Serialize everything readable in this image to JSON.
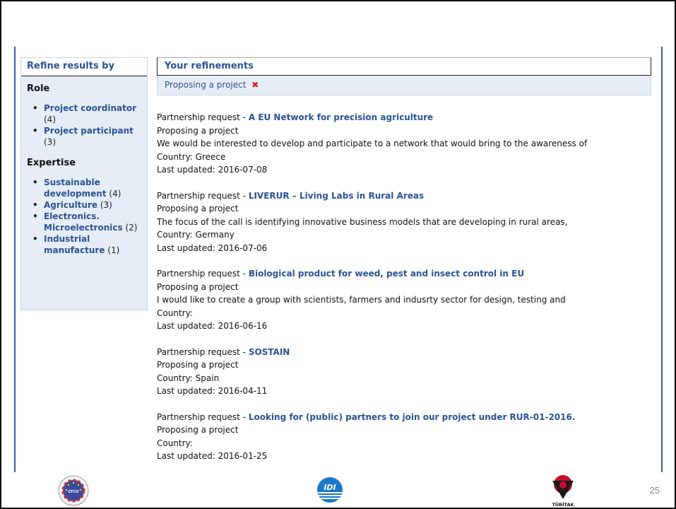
{
  "sidebar": {
    "header": "Refine results by",
    "facets": [
      {
        "title": "Role",
        "items": [
          {
            "label": "Project coordinator",
            "count": "(4)"
          },
          {
            "label": "Project participant",
            "count": "(3)"
          }
        ]
      },
      {
        "title": "Expertise",
        "items": [
          {
            "label": "Sustainable development",
            "count": "(4)"
          },
          {
            "label": "Agriculture",
            "count": "(3)"
          },
          {
            "label": "Electronics. Microelectronics",
            "count": "(2)"
          },
          {
            "label": "Industrial manufacture",
            "count": "(1)"
          }
        ]
      }
    ]
  },
  "refinements": {
    "header": "Your refinements",
    "active": "Proposing a project",
    "remove_glyph": "✖"
  },
  "results": [
    {
      "type": "Partnership request - ",
      "title": "A EU Network for precision agriculture",
      "subtitle": "Proposing a project",
      "description": "We would be interested to develop and participate to a network that would bring to the awareness of",
      "country": "Country: Greece",
      "updated": "Last updated: 2016-07-08"
    },
    {
      "type": "Partnership request - ",
      "title": "LIVERUR – Living Labs in Rural Areas",
      "subtitle": "Proposing a project",
      "description": "The focus of the call is identifying innovative business models that are developing in rural areas,",
      "country": "Country: Germany",
      "updated": "Last updated: 2016-07-06"
    },
    {
      "type": "Partnership request - ",
      "title": "Biological product for weed, pest and insect control in EU",
      "subtitle": "Proposing a project",
      "description": "I would like to create a group with scientists, farmers and indusrty sector for design, testing and",
      "country": "Country:",
      "updated": "Last updated: 2016-06-16"
    },
    {
      "type": "Partnership request - ",
      "title": "SOSTAIN",
      "subtitle": "Proposing a project",
      "description": "",
      "country": "Country: Spain",
      "updated": "Last updated: 2016-04-11"
    },
    {
      "type": "Partnership request - ",
      "title": "Looking for (public) partners to join our project under RUR-01-2016.",
      "subtitle": "Proposing a project",
      "description": "",
      "country": "Country:",
      "updated": "Last updated: 2016-01-25"
    }
  ],
  "footer": {
    "logo_cfcu": "CFCU",
    "logo_idi": "IDI",
    "logo_tubitak": "TÜBİTAK",
    "page_number": "25"
  },
  "colors": {
    "link": "#2a5395",
    "panel_bg": "#e6edf6",
    "remove": "#d22222"
  }
}
